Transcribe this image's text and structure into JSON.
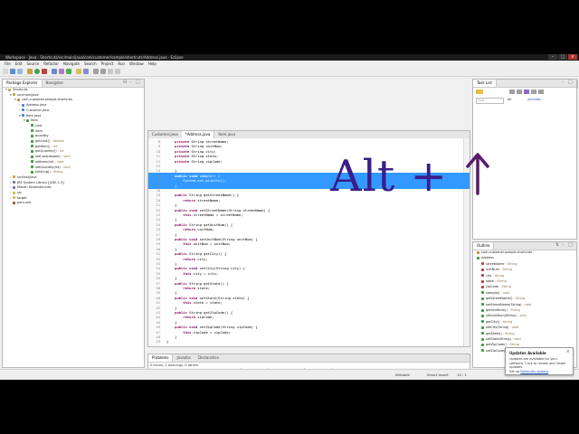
{
  "window": {
    "title": "Workspace - Java - Shortcuts/src/main/java/com/customer/sample/shortcuts/Address.java - Eclipse"
  },
  "menu": [
    "File",
    "Edit",
    "Source",
    "Refactor",
    "Navigate",
    "Search",
    "Project",
    "Run",
    "Window",
    "Help"
  ],
  "toolbar": {
    "quick_access_placeholder": "Quick Access"
  },
  "package_explorer": {
    "tabs": [
      "Package Explorer",
      "Navigator"
    ],
    "tree": [
      {
        "label": "Shortcuts",
        "indent": 0,
        "twisty": "▾",
        "icon": "project-icon",
        "color": "#c9a24a"
      },
      {
        "label": "src/main/java",
        "indent": 1,
        "twisty": "▾",
        "icon": "source-folder-icon",
        "color": "#c9a24a"
      },
      {
        "label": "com.customer.sample.shortcuts",
        "indent": 2,
        "twisty": "▾",
        "icon": "package-icon",
        "color": "#c08a3a"
      },
      {
        "label": "Address.java",
        "indent": 3,
        "twisty": "›",
        "icon": "java-file-icon",
        "color": "#4a7fc9"
      },
      {
        "label": "Customer.java",
        "indent": 3,
        "twisty": "›",
        "icon": "java-file-icon",
        "color": "#4a7fc9"
      },
      {
        "label": "Item.java",
        "indent": 3,
        "twisty": "▾",
        "icon": "java-file-icon",
        "color": "#4a7fc9"
      },
      {
        "label": "Item",
        "indent": 4,
        "twisty": "▾",
        "icon": "class-icon",
        "color": "#3a9a3a"
      },
      {
        "label": "cost",
        "indent": 5,
        "twisty": "",
        "icon": "field-icon",
        "color": "#3a9a3a"
      },
      {
        "label": "item",
        "indent": 5,
        "twisty": "",
        "icon": "field-icon",
        "color": "#3a9a3a"
      },
      {
        "label": "quantity",
        "indent": 5,
        "twisty": "",
        "icon": "field-icon",
        "color": "#3a9a3a"
      },
      {
        "label": "getCost()",
        "type": " : double",
        "indent": 5,
        "twisty": "",
        "icon": "method-icon",
        "color": "#3a9a3a"
      },
      {
        "label": "getItem()",
        "type": " : int",
        "indent": 5,
        "twisty": "",
        "icon": "method-icon",
        "color": "#3a9a3a"
      },
      {
        "label": "getQuantity()",
        "type": " : int",
        "indent": 5,
        "twisty": "",
        "icon": "method-icon",
        "color": "#3a9a3a"
      },
      {
        "label": "setCost(double)",
        "type": " : void",
        "indent": 5,
        "twisty": "",
        "icon": "method-icon",
        "color": "#3a9a3a"
      },
      {
        "label": "setItem(int)",
        "type": " : void",
        "indent": 5,
        "twisty": "",
        "icon": "method-icon",
        "color": "#3a9a3a"
      },
      {
        "label": "setQuantity(int)",
        "type": " : void",
        "indent": 5,
        "twisty": "",
        "icon": "method-icon",
        "color": "#3a9a3a"
      },
      {
        "label": "toString()",
        "type": " : String",
        "indent": 5,
        "twisty": "",
        "icon": "method-icon",
        "color": "#3a9a3a"
      },
      {
        "label": "src/test/java",
        "indent": 1,
        "twisty": "›",
        "icon": "source-folder-icon",
        "color": "#c9a24a"
      },
      {
        "label": "JRE System Library [J2SE-1.5]",
        "indent": 1,
        "twisty": "›",
        "icon": "library-icon",
        "color": "#7a6a9a"
      },
      {
        "label": "Maven Dependencies",
        "indent": 1,
        "twisty": "›",
        "icon": "library-icon",
        "color": "#7a6a9a"
      },
      {
        "label": "src",
        "indent": 1,
        "twisty": "›",
        "icon": "folder-icon",
        "color": "#d8b54a"
      },
      {
        "label": "target",
        "indent": 1,
        "twisty": "›",
        "icon": "folder-icon",
        "color": "#d8b54a"
      },
      {
        "label": "pom.xml",
        "indent": 1,
        "twisty": "",
        "icon": "xml-file-icon",
        "color": "#9a5a2a"
      }
    ]
  },
  "editor": {
    "tabs": [
      "Customer.java",
      "*Address.java",
      "Item.java"
    ],
    "active_tab": 1,
    "lines": [
      {
        "n": "8",
        "code": "    private String streetName;"
      },
      {
        "n": "9",
        "code": "    private String unitNum;"
      },
      {
        "n": "10",
        "code": "    private String city;"
      },
      {
        "n": "11",
        "code": "    private String state;"
      },
      {
        "n": "12",
        "code": "    private String zipCode;"
      },
      {
        "n": "13",
        "code": ""
      },
      {
        "n": "14",
        "code": "    }"
      },
      {
        "n": "15",
        "code": "    public void sample() {",
        "sel": true
      },
      {
        "n": "16",
        "code": "        System.out.println();",
        "sel": true
      },
      {
        "n": "17",
        "code": "    }",
        "sel": true
      },
      {
        "n": "18",
        "code": ""
      },
      {
        "n": "19",
        "code": "    public String getStreetName() {"
      },
      {
        "n": "20",
        "code": "        return streetName;"
      },
      {
        "n": "21",
        "code": "    }"
      },
      {
        "n": "22",
        "code": "    public void setStreetName(String streetName) {"
      },
      {
        "n": "23",
        "code": "        this.streetName = streetName;"
      },
      {
        "n": "24",
        "code": "    }"
      },
      {
        "n": "25",
        "code": "    public String getUnitNum() {"
      },
      {
        "n": "26",
        "code": "        return unitNum;"
      },
      {
        "n": "27",
        "code": "    }"
      },
      {
        "n": "28",
        "code": "    public void setUnitNum(String unitNum) {"
      },
      {
        "n": "29",
        "code": "        this.unitNum = unitNum;"
      },
      {
        "n": "30",
        "code": "    }"
      },
      {
        "n": "31",
        "code": "    public String getCity() {"
      },
      {
        "n": "32",
        "code": "        return city;"
      },
      {
        "n": "33",
        "code": "    }"
      },
      {
        "n": "34",
        "code": "    public void setCity(String city) {"
      },
      {
        "n": "35",
        "code": "        this.city = city;"
      },
      {
        "n": "36",
        "code": "    }"
      },
      {
        "n": "37",
        "code": "    public String getState() {"
      },
      {
        "n": "38",
        "code": "        return state;"
      },
      {
        "n": "39",
        "code": "    }"
      },
      {
        "n": "40",
        "code": "    public void setState(String state) {"
      },
      {
        "n": "41",
        "code": "        this.state = state;"
      },
      {
        "n": "42",
        "code": "    }"
      },
      {
        "n": "43",
        "code": "    public String getZipCode() {"
      },
      {
        "n": "44",
        "code": "        return zipCode;"
      },
      {
        "n": "45",
        "code": "    }"
      },
      {
        "n": "46",
        "code": "    public void setZipCode(String zipCode) {"
      },
      {
        "n": "47",
        "code": "        this.zipCode = zipCode;"
      },
      {
        "n": "48",
        "code": "    }"
      },
      {
        "n": "49",
        "code": "}"
      }
    ]
  },
  "overlay": {
    "text": "Alt +"
  },
  "task_list": {
    "title": "Task List",
    "find_placeholder": "Find",
    "filter_all": "All",
    "activate": "Activate..."
  },
  "outline": {
    "title": "Outline",
    "items": [
      {
        "label": "com.customer.sample.shortcuts",
        "type": "",
        "indent": 0,
        "icon": "package-icon",
        "color": "#c08a3a"
      },
      {
        "label": "Address",
        "type": "",
        "indent": 0,
        "icon": "class-icon",
        "color": "#3a9a3a"
      },
      {
        "label": "streetName",
        "type": " : String",
        "indent": 1,
        "icon": "field-icon",
        "color": "#c03a3a"
      },
      {
        "label": "unitNum",
        "type": " : String",
        "indent": 1,
        "icon": "field-icon",
        "color": "#c03a3a"
      },
      {
        "label": "city",
        "type": " : String",
        "indent": 1,
        "icon": "field-icon",
        "color": "#c03a3a"
      },
      {
        "label": "state",
        "type": " : String",
        "indent": 1,
        "icon": "field-icon",
        "color": "#c03a3a"
      },
      {
        "label": "zipCode",
        "type": " : String",
        "indent": 1,
        "icon": "field-icon",
        "color": "#c03a3a"
      },
      {
        "label": "sample()",
        "type": " : void",
        "indent": 1,
        "icon": "method-icon",
        "color": "#3a9a3a"
      },
      {
        "label": "getStreetName()",
        "type": " : String",
        "indent": 1,
        "icon": "method-icon",
        "color": "#3a9a3a"
      },
      {
        "label": "setStreetName(String)",
        "type": " : void",
        "indent": 1,
        "icon": "method-icon",
        "color": "#3a9a3a"
      },
      {
        "label": "getUnitNum()",
        "type": " : String",
        "indent": 1,
        "icon": "method-icon",
        "color": "#3a9a3a"
      },
      {
        "label": "setUnitNum(String)",
        "type": " : void",
        "indent": 1,
        "icon": "method-icon",
        "color": "#3a9a3a"
      },
      {
        "label": "getCity()",
        "type": " : String",
        "indent": 1,
        "icon": "method-icon",
        "color": "#3a9a3a"
      },
      {
        "label": "setCity(String)",
        "type": " : void",
        "indent": 1,
        "icon": "method-icon",
        "color": "#3a9a3a"
      },
      {
        "label": "getState()",
        "type": " : String",
        "indent": 1,
        "icon": "method-icon",
        "color": "#3a9a3a"
      },
      {
        "label": "setState(String)",
        "type": " : void",
        "indent": 1,
        "icon": "method-icon",
        "color": "#3a9a3a"
      },
      {
        "label": "getZipCode()",
        "type": " : String",
        "indent": 1,
        "icon": "method-icon",
        "color": "#3a9a3a"
      },
      {
        "label": "setZipCode(String)",
        "type": " : void",
        "indent": 1,
        "icon": "method-icon",
        "color": "#3a9a3a"
      }
    ]
  },
  "problems": {
    "tabs": [
      "Problems",
      "Javadoc",
      "Declaration"
    ],
    "summary": "0 errors, 2 warnings, 0 others",
    "columns": [
      "Description",
      "Resource",
      "Path",
      "Location",
      "Type"
    ],
    "row": "Warnings (2 items)"
  },
  "status": {
    "writable": "Writable",
    "insert": "Smart Insert",
    "position": "15 : 1"
  },
  "popup": {
    "title": "Updates Available",
    "body": "Updates are available for your software. Click to review and install updates.",
    "setup_prefix": "Set up ",
    "setup_link": "Reminder options"
  },
  "colors": {
    "selection": "#3399ff",
    "overlay": "#3a1e8a",
    "arrow": "#5a1a6a"
  }
}
